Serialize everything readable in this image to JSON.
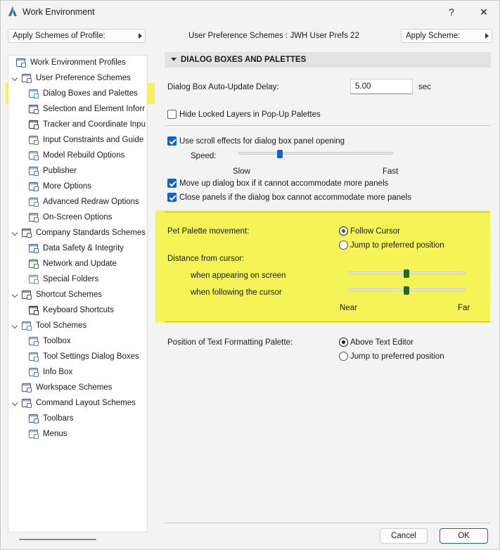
{
  "window": {
    "title": "Work Environment",
    "help": "?",
    "close": "✕"
  },
  "toolbar": {
    "apply_profile": "Apply Schemes of Profile:",
    "scheme_status": "User Preference Schemes : JWH User Prefs 22",
    "apply_scheme": "Apply Scheme:"
  },
  "tree": [
    {
      "label": "Work Environment Profiles",
      "icon": "profiles-icon"
    },
    {
      "label": "User Preference Schemes",
      "icon": "user-prefs-icon"
    },
    {
      "label": "Dialog Boxes and Palettes",
      "icon": "dialog-boxes-icon"
    },
    {
      "label": "Selection and Element Inforr",
      "icon": "selection-icon"
    },
    {
      "label": "Tracker and Coordinate Inpu",
      "icon": "tracker-icon"
    },
    {
      "label": "Input Constraints and Guide",
      "icon": "input-constraints-icon"
    },
    {
      "label": "Model Rebuild Options",
      "icon": "model-rebuild-icon"
    },
    {
      "label": "Publisher",
      "icon": "publisher-icon"
    },
    {
      "label": "More Options",
      "icon": "more-options-icon"
    },
    {
      "label": "Advanced Redraw Options",
      "icon": "redraw-icon"
    },
    {
      "label": "On-Screen Options",
      "icon": "on-screen-icon"
    },
    {
      "label": "Company Standards Schemes",
      "icon": "company-standards-icon"
    },
    {
      "label": "Data Safety & Integrity",
      "icon": "data-safety-icon"
    },
    {
      "label": "Network and Update",
      "icon": "network-globe-icon"
    },
    {
      "label": "Special Folders",
      "icon": "special-folders-icon"
    },
    {
      "label": "Shortcut Schemes",
      "icon": "shortcut-schemes-icon"
    },
    {
      "label": "Keyboard Shortcuts",
      "icon": "keyboard-shortcuts-icon"
    },
    {
      "label": "Tool Schemes",
      "icon": "tool-schemes-icon"
    },
    {
      "label": "Toolbox",
      "icon": "toolbox-icon"
    },
    {
      "label": "Tool Settings Dialog Boxes",
      "icon": "tool-settings-icon"
    },
    {
      "label": "Info Box",
      "icon": "info-box-icon"
    },
    {
      "label": "Workspace Schemes",
      "icon": "workspace-icon"
    },
    {
      "label": "Command Layout Schemes",
      "icon": "command-layout-icon"
    },
    {
      "label": "Toolbars",
      "icon": "toolbars-icon"
    },
    {
      "label": "Menus",
      "icon": "menus-icon"
    }
  ],
  "panel": {
    "section_title": "DIALOG BOXES AND PALETTES",
    "delay_label": "Dialog Box Auto-Update Delay:",
    "delay_value": "5.00",
    "delay_unit": "sec",
    "hide_locked": "Hide Locked Layers in Pop-Up Palettes",
    "scroll_effects": "Use scroll effects for dialog box panel opening",
    "speed_label": "Speed:",
    "speed_slow": "Slow",
    "speed_fast": "Fast",
    "speed_level": 0.27,
    "move_up": "Move up dialog box if it cannot accommodate more panels",
    "close_panels": "Close panels if the dialog box cannot accommodate more panels",
    "pet_label": "Pet Palette movement:",
    "pet_follow": "Follow Cursor",
    "pet_jump": "Jump to preferred position",
    "distance_label": "Distance from cursor:",
    "appearing": "when appearing on screen",
    "following": "when following the cursor",
    "appearing_level": 0.5,
    "following_level": 0.5,
    "near": "Near",
    "far": "Far",
    "text_palette_label": "Position of Text Formatting Palette:",
    "text_above": "Above Text Editor",
    "text_jump": "Jump to preferred position"
  },
  "footer": {
    "cancel": "Cancel",
    "ok": "OK"
  },
  "colors": {
    "accent": "#1565c0",
    "highlight": "#f4f456",
    "slider_green": "#1f6b1f"
  }
}
